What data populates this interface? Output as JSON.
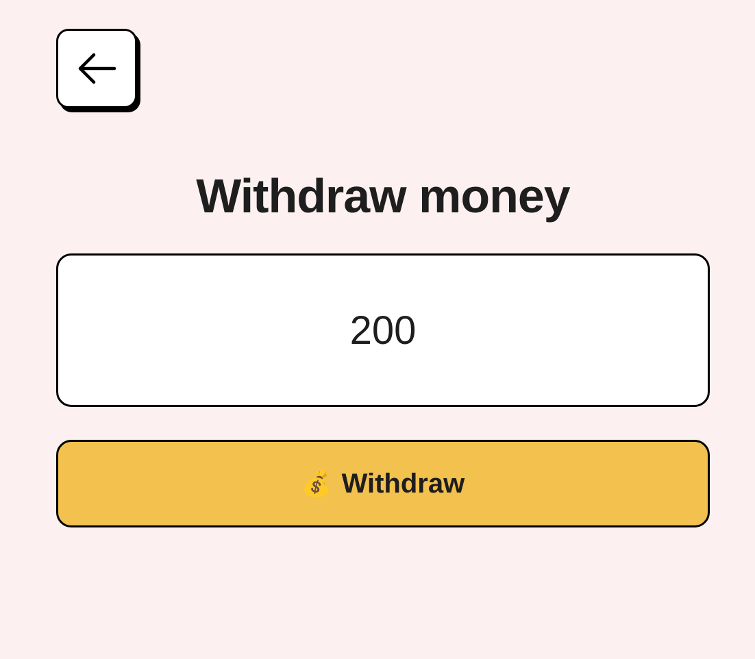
{
  "header": {
    "back_icon": "arrow-left-icon"
  },
  "page": {
    "title": "Withdraw money"
  },
  "amount": {
    "value": "200"
  },
  "withdraw_button": {
    "emoji": "💰",
    "label": "Withdraw",
    "color": "#f2c14e"
  },
  "colors": {
    "background": "#fcf1f0",
    "text": "#1e1e1e",
    "border": "#000000"
  }
}
